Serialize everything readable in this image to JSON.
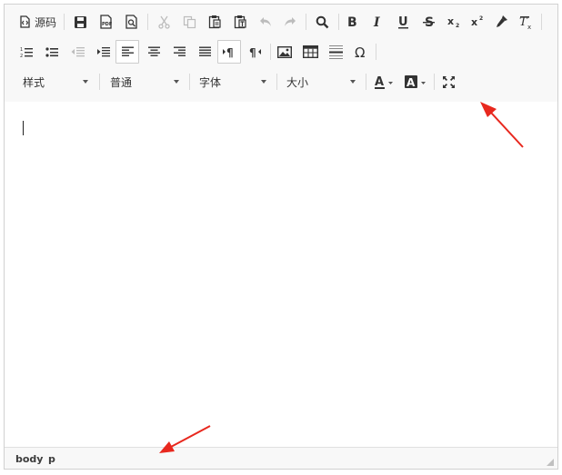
{
  "toolbar": {
    "source_label": "源码",
    "combos": {
      "format": "样式",
      "paragraph": "普通",
      "font": "字体",
      "size": "大小"
    }
  },
  "statusbar": {
    "path": [
      "body",
      "p"
    ]
  },
  "icons": [
    "source-icon",
    "save-icon",
    "pdf-icon",
    "preview-icon",
    "cut-icon",
    "copy-icon",
    "paste-icon",
    "paste-text-icon",
    "undo-icon",
    "redo-icon",
    "find-icon",
    "bold-icon",
    "italic-icon",
    "underline-icon",
    "strikethrough-icon",
    "subscript-icon",
    "superscript-icon",
    "format-painter-icon",
    "clear-format-icon",
    "numbered-list-icon",
    "bulleted-list-icon",
    "outdent-icon",
    "indent-icon",
    "align-left-icon",
    "align-center-icon",
    "align-right-icon",
    "justify-icon",
    "ltr-icon",
    "rtl-icon",
    "image-icon",
    "table-icon",
    "horizontal-rule-icon",
    "special-char-icon",
    "text-color-icon",
    "background-color-icon",
    "maximize-icon"
  ],
  "colors": {
    "arrow": "#e8281e",
    "toolbar_bg": "#f8f8f8",
    "border": "#d1d1d1"
  }
}
